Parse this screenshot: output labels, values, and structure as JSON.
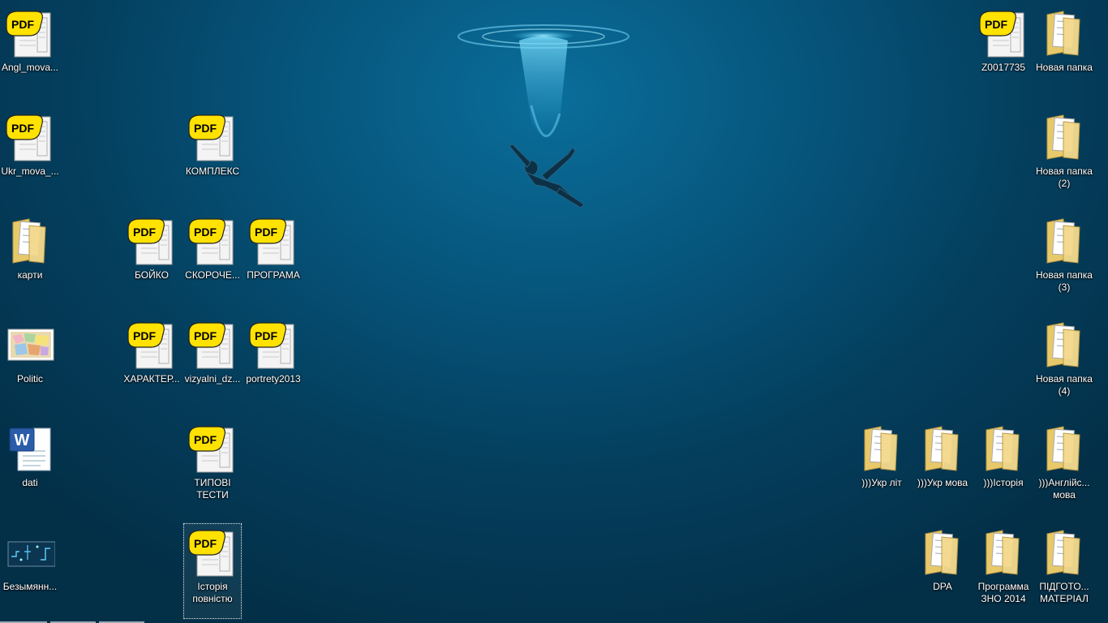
{
  "desktop": {
    "icons": [
      {
        "label": "Angl_mova...",
        "type": "pdf"
      },
      {
        "label": "Ukr_mova_...",
        "type": "pdf"
      },
      {
        "label": "карти",
        "type": "folder"
      },
      {
        "label": "Politic",
        "type": "image"
      },
      {
        "label": "dati",
        "type": "word"
      },
      {
        "label": "Безымянн...",
        "type": "image-dark"
      },
      {
        "label": "КОМПЛЕКС",
        "type": "pdf"
      },
      {
        "label": "БОЙКО",
        "type": "pdf"
      },
      {
        "label": "СКОРОЧЕ...",
        "type": "pdf"
      },
      {
        "label": "ПРОГРАМА",
        "type": "pdf"
      },
      {
        "label": "ХАРАКТЕР...",
        "type": "pdf"
      },
      {
        "label": "vizyalni_dz...",
        "type": "pdf"
      },
      {
        "label": "portrety2013",
        "type": "pdf"
      },
      {
        "label": "ТИПОВІ\nТЕСТИ",
        "type": "pdf"
      },
      {
        "label": "Історія\nповністю",
        "type": "pdf",
        "selected": true
      },
      {
        "label": "Z0017735",
        "type": "pdf"
      },
      {
        "label": "Новая папка",
        "type": "folder"
      },
      {
        "label": "Новая папка\n(2)",
        "type": "folder"
      },
      {
        "label": "Новая папка\n(3)",
        "type": "folder"
      },
      {
        "label": "Новая папка\n(4)",
        "type": "folder"
      },
      {
        "label": ")))Укр літ",
        "type": "folder"
      },
      {
        "label": ")))Укр мова",
        "type": "folder"
      },
      {
        "label": ")))Історія",
        "type": "folder"
      },
      {
        "label": ")))Англійс...\nмова",
        "type": "folder"
      },
      {
        "label": "DPA",
        "type": "folder"
      },
      {
        "label": "Программа\nЗНО 2014",
        "type": "folder"
      },
      {
        "label": "ПІДГОТО...\nМАТЕРІАЛ",
        "type": "folder"
      }
    ],
    "pdf_badge_text": "PDF",
    "word_badge_text": "W"
  },
  "colors": {
    "pdf_yellow": "#ffe200",
    "folder": "#e8c96a",
    "text": "#ffffff"
  }
}
